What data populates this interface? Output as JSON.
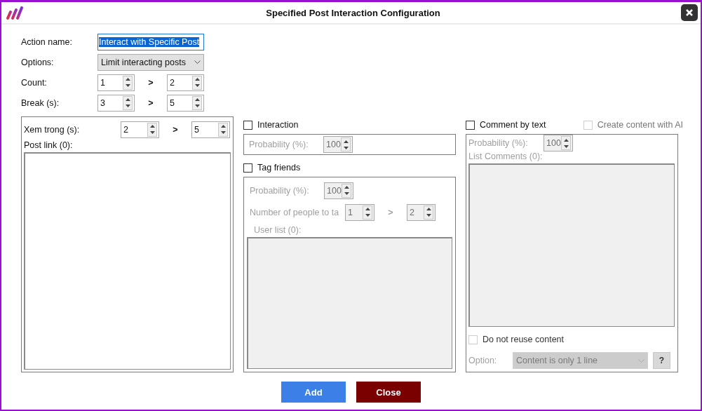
{
  "window": {
    "title": "Specified Post Interaction Configuration"
  },
  "form": [
    {
      "kind": "text",
      "label": "Action name:",
      "value": "Interact with Specific Post",
      "text_selected": true
    },
    {
      "kind": "select",
      "label": "Options:",
      "value": "Limit interacting posts"
    },
    {
      "kind": "range",
      "label": "Count:",
      "from": "1",
      "separator": ">",
      "to": "2"
    },
    {
      "kind": "range",
      "label": "Break (s):",
      "from": "3",
      "separator": ">",
      "to": "5"
    }
  ],
  "left_panel": {
    "watch": {
      "label": "Xem trong (s):",
      "from": "2",
      "separator": ">",
      "to": "5"
    },
    "post_link": {
      "label": "Post link (0):"
    }
  },
  "interaction": {
    "label": "Interaction",
    "checked": false,
    "disabled": true,
    "probability": {
      "label": "Probability (%):",
      "value": "100"
    }
  },
  "tag_friends": {
    "label": "Tag friends",
    "checked": false,
    "disabled": true,
    "probability": {
      "label": "Probability (%):",
      "value": "100"
    },
    "people": {
      "label": "Number of people to ta",
      "from": "1",
      "separator": ">",
      "to": "2"
    },
    "user_list": {
      "label": "User list (0):"
    }
  },
  "comment": {
    "label": "Comment by text",
    "checked": false,
    "disabled": true,
    "ai": {
      "label": "Create content with AI",
      "checked": false
    },
    "probability": {
      "label": "Probability (%):",
      "value": "100"
    },
    "list": {
      "label": "List Comments (0):"
    },
    "no_reuse": {
      "label": "Do not reuse content",
      "checked": false
    },
    "option": {
      "label": "Option:",
      "value": "Content is only 1 line"
    },
    "help": "?"
  },
  "buttons": [
    {
      "kind": "primary",
      "label": "Add"
    },
    {
      "kind": "danger",
      "label": "Close"
    }
  ]
}
